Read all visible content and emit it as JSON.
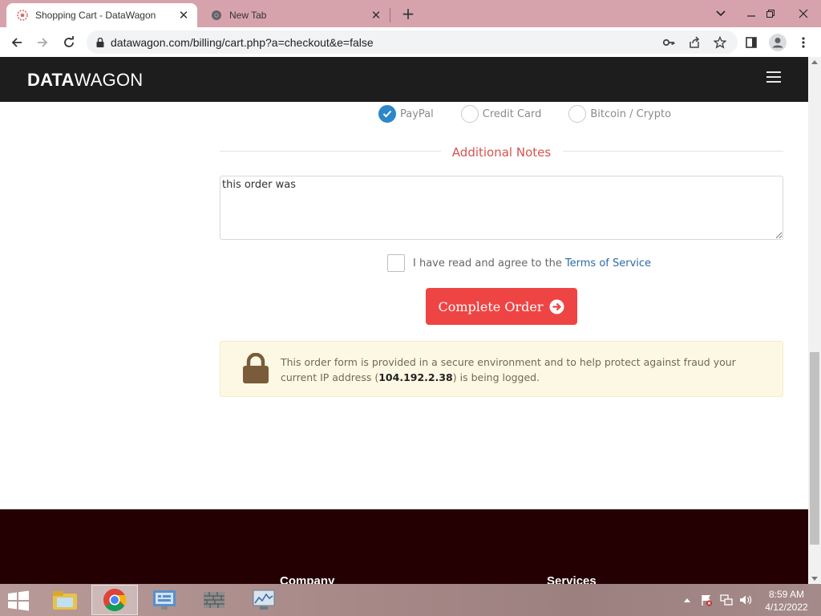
{
  "browser": {
    "tabs": [
      {
        "title": "Shopping Cart - DataWagon",
        "active": true
      },
      {
        "title": "New Tab",
        "active": false
      }
    ],
    "url": "datawagon.com/billing/cart.php?a=checkout&e=false"
  },
  "site": {
    "logo_bold": "DATA",
    "logo_thin": "WAGON"
  },
  "payment": {
    "options": [
      {
        "label": "PayPal",
        "checked": true
      },
      {
        "label": "Credit Card",
        "checked": false
      },
      {
        "label": "Bitcoin / Crypto",
        "checked": false
      }
    ]
  },
  "notes": {
    "heading": "Additional Notes",
    "value": "this order was "
  },
  "tos": {
    "text": "I have read and agree to the",
    "link": "Terms of Service",
    "checked": false
  },
  "complete_button": {
    "label": "Complete Order"
  },
  "secure": {
    "text_before": "This order form is provided in a secure environment and to help protect against fraud your current IP address (",
    "ip": "104.192.2.38",
    "text_after": ") is being logged."
  },
  "footer": {
    "columns": [
      "Company",
      "Services"
    ]
  },
  "taskbar": {
    "time": "8:59 AM",
    "date": "4/12/2022"
  },
  "colors": {
    "accent_red": "#ef4444",
    "heading_red": "#d9534f",
    "radio_blue": "#2d87c8",
    "header_bg": "#1d1d1d",
    "footer_bg": "#250003"
  },
  "icons": [
    "datawagon-favicon",
    "chrome-favicon",
    "back-arrow-icon",
    "forward-arrow-icon",
    "reload-icon",
    "lock-icon",
    "key-icon",
    "share-icon",
    "star-icon",
    "sidepanel-icon",
    "profile-icon",
    "kebab-menu-icon",
    "hamburger-menu-icon",
    "checkmark-icon",
    "arrow-circle-right-icon",
    "padlock-icon",
    "windows-start-icon"
  ]
}
